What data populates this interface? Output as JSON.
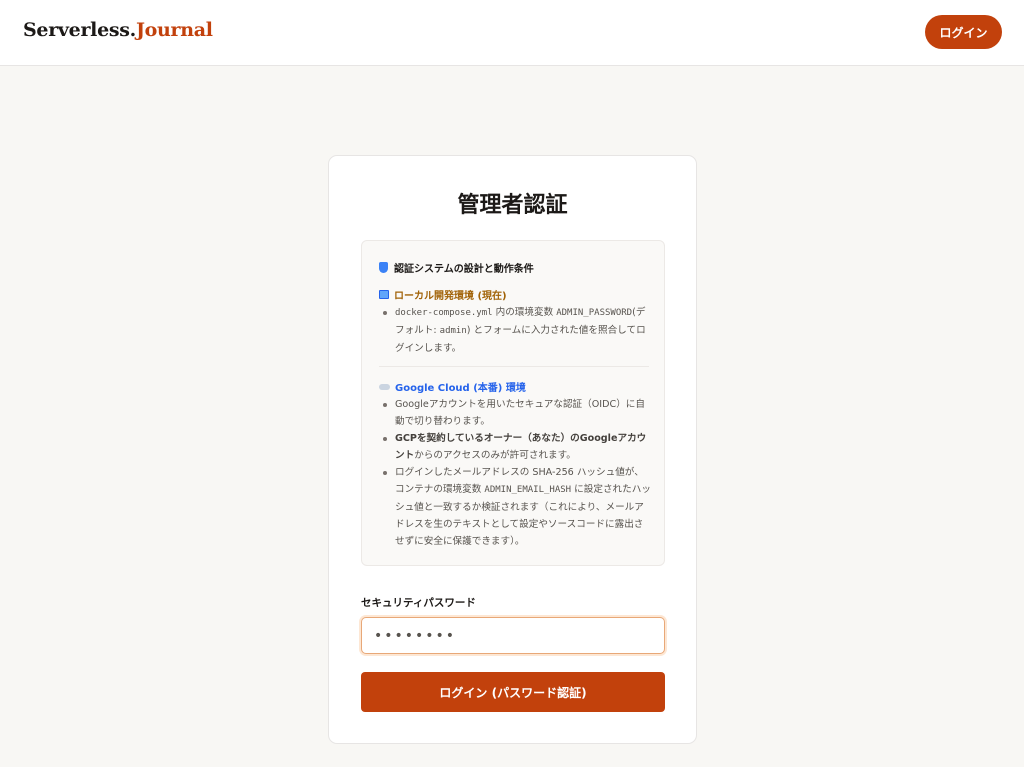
{
  "header": {
    "logo_main": "Serverless.",
    "logo_accent": "Journal",
    "login_label": "ログイン"
  },
  "card": {
    "title": "管理者認証",
    "info": {
      "heading": "認証システムの設計と動作条件",
      "local": {
        "title": "ローカル開発環境 (現在)",
        "b1_code1": "docker-compose.yml",
        "b1_t1": " 内の環境変数 ",
        "b1_code2": "ADMIN_PASSWORD",
        "b1_t2": "(デフォルト: ",
        "b1_code3": "admin",
        "b1_t3": ") とフォームに入力された値を照合してログインします。"
      },
      "cloud": {
        "title": "Google Cloud (本番) 環境",
        "b1": "Googleアカウントを用いたセキュアな認証（OIDC）に自動で切り替わります。",
        "b2_strong": "GCPを契約しているオーナー（あなた）のGoogleアカウント",
        "b2_t": "からのアクセスのみが許可されます。",
        "b3_t1": "ログインしたメールアドレスの SHA-256 ハッシュ値が、コンテナの環境変数 ",
        "b3_code": "ADMIN_EMAIL_HASH",
        "b3_t2": " に設定されたハッシュ値と一致するか検証されます（これにより、メールアドレスを生のテキストとして設定やソースコードに露出させずに安全に保護できます）。"
      }
    },
    "password_label": "セキュリティパスワード",
    "password_value": "••••••••",
    "submit_label": "ログイン (パスワード認証)"
  },
  "colors": {
    "accent": "#c2410c",
    "local_title": "#a16207",
    "cloud_title": "#2563eb"
  },
  "icons": {
    "info": "shield-icon",
    "local": "monitor-icon",
    "cloud": "cloud-icon"
  }
}
